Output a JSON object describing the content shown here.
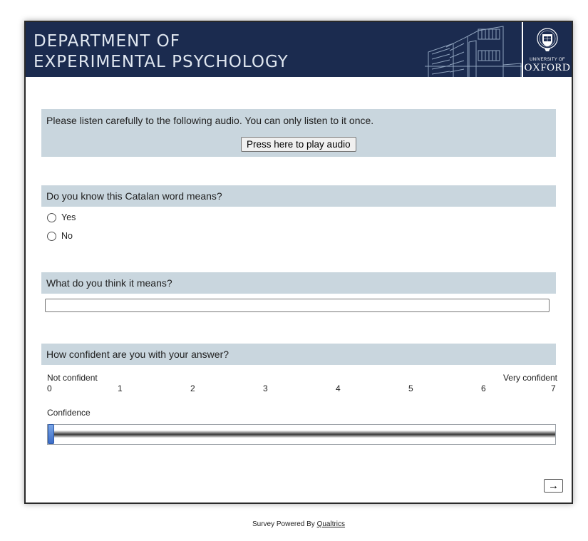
{
  "header": {
    "dept_line1": "DEPARTMENT OF",
    "dept_line2": "EXPERIMENTAL PSYCHOLOGY",
    "university_small": "UNIVERSITY OF",
    "university_name": "OXFORD",
    "colors": {
      "banner": "#1b2b4f",
      "question_bg": "#c9d6de"
    }
  },
  "q1": {
    "text": "Please listen carefully to the following audio. You can only listen to it once.",
    "play_button_label": "Press here to play audio"
  },
  "q2": {
    "text": "Do you know this Catalan word means?",
    "options": [
      "Yes",
      "No"
    ]
  },
  "q3": {
    "text": "What do you think it means?",
    "value": ""
  },
  "q4": {
    "text": "How confident are you with your answer?",
    "left_label": "Not confident",
    "right_label": "Very confident",
    "ticks": [
      "0",
      "1",
      "2",
      "3",
      "4",
      "5",
      "6",
      "7"
    ],
    "slider_label": "Confidence",
    "slider_min": 0,
    "slider_max": 7,
    "slider_value": 0
  },
  "navigation": {
    "next_label": "→",
    "next_icon": "arrow-right-icon"
  },
  "footer": {
    "prefix": "Survey Powered By",
    "link": "Qualtrics"
  }
}
